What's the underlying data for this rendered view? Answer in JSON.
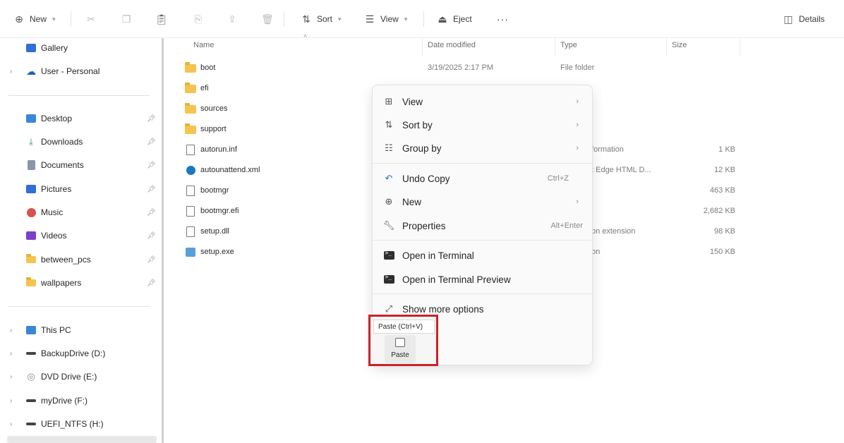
{
  "toolbar": {
    "new_label": "New",
    "sort_label": "Sort",
    "view_label": "View",
    "eject_label": "Eject",
    "more_label": "···",
    "details_label": "Details"
  },
  "sidebar": {
    "items": [
      {
        "label": "Gallery"
      },
      {
        "label": "User - Personal"
      },
      {
        "label": "Desktop"
      },
      {
        "label": "Downloads"
      },
      {
        "label": "Documents"
      },
      {
        "label": "Pictures"
      },
      {
        "label": "Music"
      },
      {
        "label": "Videos"
      },
      {
        "label": "between_pcs"
      },
      {
        "label": "wallpapers"
      },
      {
        "label": "This PC"
      },
      {
        "label": "BackupDrive (D:)"
      },
      {
        "label": "DVD Drive (E:)"
      },
      {
        "label": "myDrive (F:)"
      },
      {
        "label": "UEFI_NTFS (H:)"
      }
    ]
  },
  "file_list": {
    "columns": {
      "name": "Name",
      "date": "Date modified",
      "type": "Type",
      "size": "Size"
    },
    "rows": [
      {
        "name": "boot",
        "date": "3/19/2025 2:17 PM",
        "type": "File folder",
        "size": ""
      },
      {
        "name": "efi",
        "date": "",
        "type": "",
        "size": ""
      },
      {
        "name": "sources",
        "date": "",
        "type": "",
        "size": ""
      },
      {
        "name": "support",
        "date": "",
        "type": "",
        "size": ""
      },
      {
        "name": "autorun.inf",
        "date": "",
        "type": "formation",
        "size": "1 KB"
      },
      {
        "name": "autounattend.xml",
        "date": "",
        "type": "t Edge HTML D...",
        "size": "12 KB"
      },
      {
        "name": "bootmgr",
        "date": "",
        "type": "",
        "size": "463 KB"
      },
      {
        "name": "bootmgr.efi",
        "date": "",
        "type": "",
        "size": "2,682 KB"
      },
      {
        "name": "setup.dll",
        "date": "",
        "type": "on extension",
        "size": "98 KB"
      },
      {
        "name": "setup.exe",
        "date": "",
        "type": "on",
        "size": "150 KB"
      }
    ]
  },
  "context_menu": {
    "view": "View",
    "sort_by": "Sort by",
    "group_by": "Group by",
    "undo_copy": "Undo Copy",
    "undo_copy_shortcut": "Ctrl+Z",
    "new": "New",
    "properties": "Properties",
    "properties_shortcut": "Alt+Enter",
    "open_terminal": "Open in Terminal",
    "open_terminal_preview": "Open in Terminal Preview",
    "show_more": "Show more options"
  },
  "paste": {
    "tooltip": "Paste (Ctrl+V)",
    "label": "Paste"
  },
  "colors": {
    "highlight_border": "#c8232c",
    "folder": "#f5c450"
  }
}
